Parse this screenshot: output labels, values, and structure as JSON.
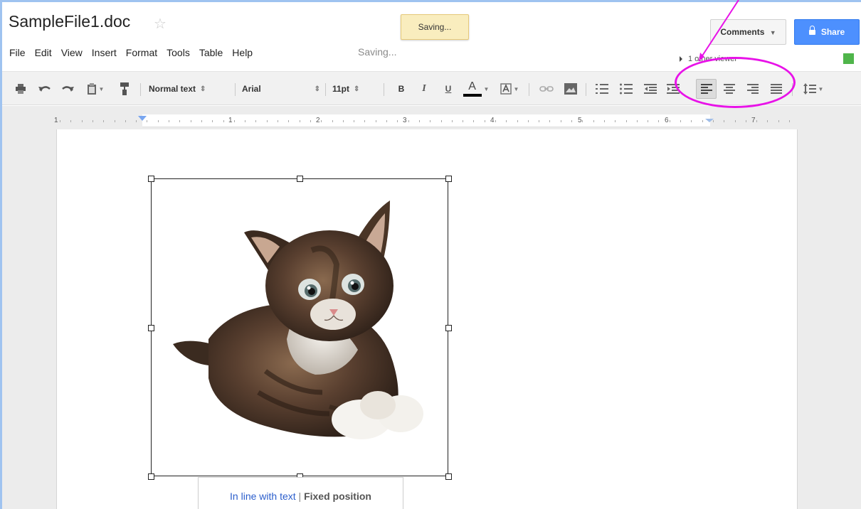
{
  "document": {
    "title": "SampleFile1.doc",
    "saving_toast": "Saving...",
    "menu_status": "Saving..."
  },
  "header": {
    "comments_label": "Comments",
    "share_label": "Share",
    "viewer_text": "1 other viewer",
    "presence_color": "#4fb54a"
  },
  "menu": {
    "items": [
      "File",
      "Edit",
      "View",
      "Insert",
      "Format",
      "Tools",
      "Table",
      "Help"
    ]
  },
  "toolbar": {
    "style_label": "Normal text",
    "font_label": "Arial",
    "size_label": "11pt",
    "bold_label": "B",
    "italic_label": "I",
    "underline_label": "U",
    "text_color_label": "A"
  },
  "ruler": {
    "labels": [
      "1",
      "1",
      "2",
      "3",
      "4",
      "5",
      "6",
      "7"
    ]
  },
  "image_popup": {
    "inline_label": "In line with text",
    "separator": "|",
    "fixed_label": "Fixed position"
  },
  "annotation": {
    "color": "#e812e8"
  }
}
